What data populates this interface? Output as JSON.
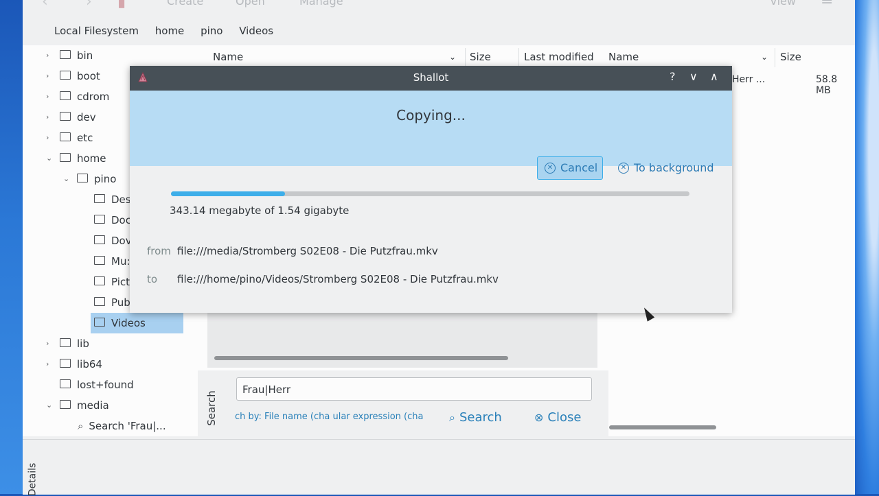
{
  "toolbar": {
    "create": "Create",
    "open": "Open",
    "manage": "Manage",
    "view": "View"
  },
  "breadcrumb": [
    "Local Filesystem",
    "home",
    "pino",
    "Videos"
  ],
  "tree": {
    "items": [
      {
        "label": "bin"
      },
      {
        "label": "boot"
      },
      {
        "label": "cdrom"
      },
      {
        "label": "dev"
      },
      {
        "label": "etc"
      },
      {
        "label": "home"
      },
      {
        "label": "pino"
      },
      {
        "label": "Des"
      },
      {
        "label": "Doc"
      },
      {
        "label": "Dov"
      },
      {
        "label": "Mu:"
      },
      {
        "label": "Pict"
      },
      {
        "label": "Pub"
      },
      {
        "label": "Videos"
      },
      {
        "label": "lib"
      },
      {
        "label": "lib64"
      },
      {
        "label": "lost+found"
      },
      {
        "label": "media"
      },
      {
        "label": "Search 'Frau|..."
      }
    ]
  },
  "list_columns": {
    "name": "Name",
    "size": "Size",
    "last_modified": "Last modified"
  },
  "right_columns": {
    "name": "Name",
    "size": "Size"
  },
  "right_row": {
    "name": "Herr ...",
    "size": "58.8 MB"
  },
  "search": {
    "label": "Search",
    "value": "Frau|Herr",
    "options_text": "ch by: File name (cha  ular expression (cha",
    "search_btn": "Search",
    "close_btn": "Close"
  },
  "details_label": "Details",
  "dialog": {
    "title": "Shallot",
    "help": "?",
    "minimize": "∨",
    "maximize": "∧",
    "heading": "Copying...",
    "cancel": "Cancel",
    "to_background": "To background",
    "progress": 0.22,
    "progress_text": "343.14 megabyte of 1.54 gigabyte",
    "from_label": "from",
    "from_value": "file:///media/Stromberg S02E08 - Die Putzfrau.mkv",
    "to_label": "to",
    "to_value": "file:///home/pino/Videos/Stromberg S02E08 - Die Putzfrau.mkv"
  },
  "colors": {
    "accent": "#3daee9",
    "banner": "#b7dcf4",
    "titlebar": "#475057",
    "selection": "#a8d0f0"
  }
}
